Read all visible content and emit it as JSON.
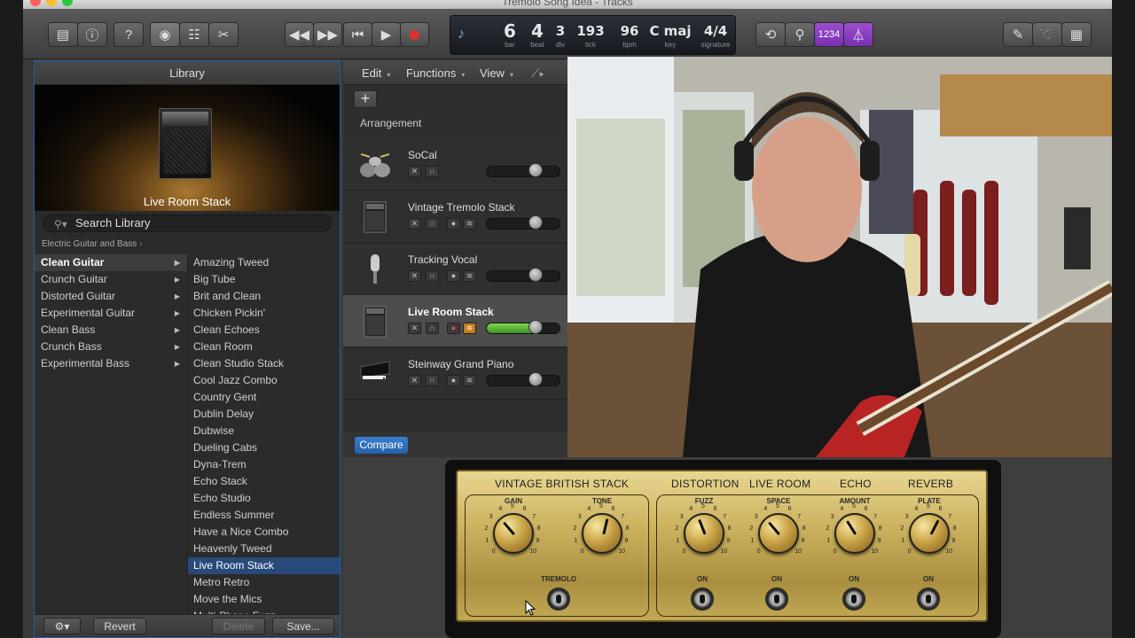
{
  "window": {
    "title": "Tremolo Song Idea - Tracks"
  },
  "toolbar": {
    "icons": [
      "library-icon",
      "info-icon",
      "help-icon",
      "smart-controls-icon",
      "mixer-icon",
      "editors-icon",
      "rewind-icon",
      "fast-forward-icon",
      "go-to-start-icon",
      "play-icon",
      "record-icon",
      "cycle-icon",
      "tuner-icon",
      "count-in-icon",
      "metronome-icon",
      "notepad-icon",
      "loop-browser-icon",
      "media-browser-icon"
    ],
    "count_in_label": "1234",
    "accent": "#8b3fbf"
  },
  "lcd": {
    "bar": "6",
    "bar_label": "bar",
    "beat": "4",
    "beat_label": "beat",
    "div": "3",
    "div_label": "div",
    "tick": "193",
    "tick_label": "tick",
    "bpm": "96",
    "bpm_label": "bpm",
    "key": "C maj",
    "key_label": "key",
    "signature": "4/4",
    "signature_label": "signature"
  },
  "library": {
    "title": "Library",
    "preview_name": "Live Room Stack",
    "search_placeholder": "Search Library",
    "breadcrumb": "Electric Guitar and Bass",
    "categories": [
      "Clean Guitar",
      "Crunch Guitar",
      "Distorted Guitar",
      "Experimental Guitar",
      "Clean Bass",
      "Crunch Bass",
      "Experimental Bass"
    ],
    "selected_category": "Clean Guitar",
    "patches": [
      "Amazing Tweed",
      "Big Tube",
      "Brit and Clean",
      "Chicken Pickin'",
      "Clean Echoes",
      "Clean Room",
      "Clean Studio Stack",
      "Cool Jazz Combo",
      "Country Gent",
      "Dublin Delay",
      "Dubwise",
      "Dueling Cabs",
      "Dyna-Trem",
      "Echo Stack",
      "Echo Studio",
      "Endless Summer",
      "Have a Nice Combo",
      "Heavenly Tweed",
      "Live Room Stack",
      "Metro Retro",
      "Move the Mics",
      "Multi-Phase Fuzz"
    ],
    "selected_patch": "Live Room Stack",
    "footer": {
      "revert": "Revert",
      "delete": "Delete",
      "save": "Save..."
    }
  },
  "tracks_area": {
    "menus": [
      "Edit",
      "Functions",
      "View"
    ],
    "add_label": "+",
    "arrangement_label": "Arrangement",
    "compare_label": "Compare",
    "tracks": [
      {
        "name": "SoCal",
        "type": "drums",
        "volume": 0.71,
        "selected": false,
        "record": false
      },
      {
        "name": "Vintage Tremolo Stack",
        "type": "amp",
        "volume": 0.71,
        "selected": false,
        "record": true
      },
      {
        "name": "Tracking Vocal",
        "type": "mic",
        "volume": 0.71,
        "selected": false,
        "record": true
      },
      {
        "name": "Live Room Stack",
        "type": "amp",
        "volume": 0.71,
        "selected": true,
        "record": true
      },
      {
        "name": "Steinway Grand Piano",
        "type": "piano",
        "volume": 0.71,
        "selected": false,
        "record": true
      }
    ]
  },
  "amp_panel": {
    "section_titles": [
      "VINTAGE BRITISH STACK",
      "DISTORTION",
      "LIVE ROOM",
      "ECHO",
      "REVERB"
    ],
    "knobs": [
      {
        "label": "GAIN",
        "value": 0.35
      },
      {
        "label": "TONE",
        "value": 0.55
      },
      {
        "label": "FUZZ",
        "value": 0.42
      },
      {
        "label": "SPACE",
        "value": 0.35
      },
      {
        "label": "AMOUNT",
        "value": 0.38
      },
      {
        "label": "PLATE",
        "value": 0.6
      }
    ],
    "scale_numbers": [
      "0",
      "1",
      "2",
      "3",
      "4",
      "5",
      "6",
      "7",
      "8",
      "9",
      "10"
    ],
    "switches": [
      "TREMOLO",
      "ON",
      "ON",
      "ON",
      "ON"
    ]
  }
}
